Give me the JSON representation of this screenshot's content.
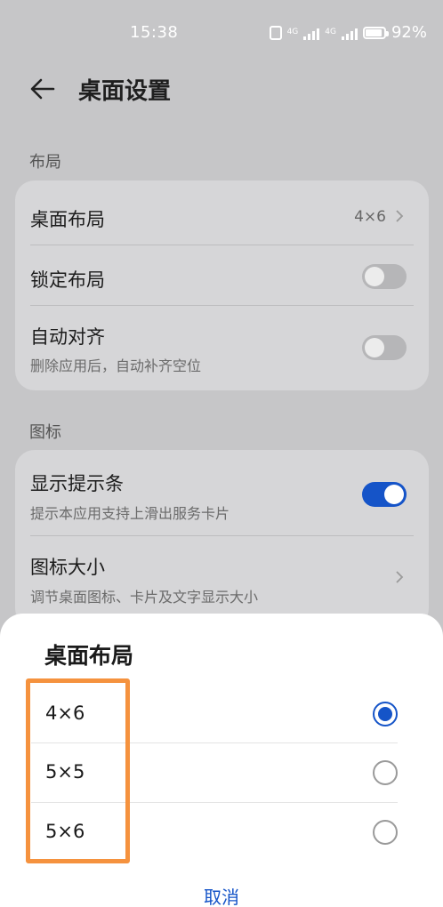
{
  "status_bar": {
    "time": "15:38",
    "battery": "92%",
    "network_1": "4G",
    "network_2": "4G"
  },
  "header": {
    "title": "桌面设置",
    "back_icon": "arrow-left-icon"
  },
  "layout_section": {
    "label": "布局",
    "items": [
      {
        "title": "桌面布局",
        "value": "4×6"
      },
      {
        "title": "锁定布局",
        "toggle": false
      },
      {
        "title": "自动对齐",
        "subtitle": "删除应用后，自动补齐空位",
        "toggle": false
      }
    ]
  },
  "icon_section": {
    "label": "图标",
    "items": [
      {
        "title": "显示提示条",
        "subtitle": "提示本应用支持上滑出服务卡片",
        "toggle": true
      },
      {
        "title": "图标大小",
        "subtitle": "调节桌面图标、卡片及文字显示大小"
      }
    ]
  },
  "sheet": {
    "title": "桌面布局",
    "options": [
      {
        "label": "4×6",
        "selected": true
      },
      {
        "label": "5×5",
        "selected": false
      },
      {
        "label": "5×6",
        "selected": false
      }
    ],
    "cancel_label": "取消",
    "accent_color": "#1554c8",
    "highlight_color": "#f5923e"
  }
}
